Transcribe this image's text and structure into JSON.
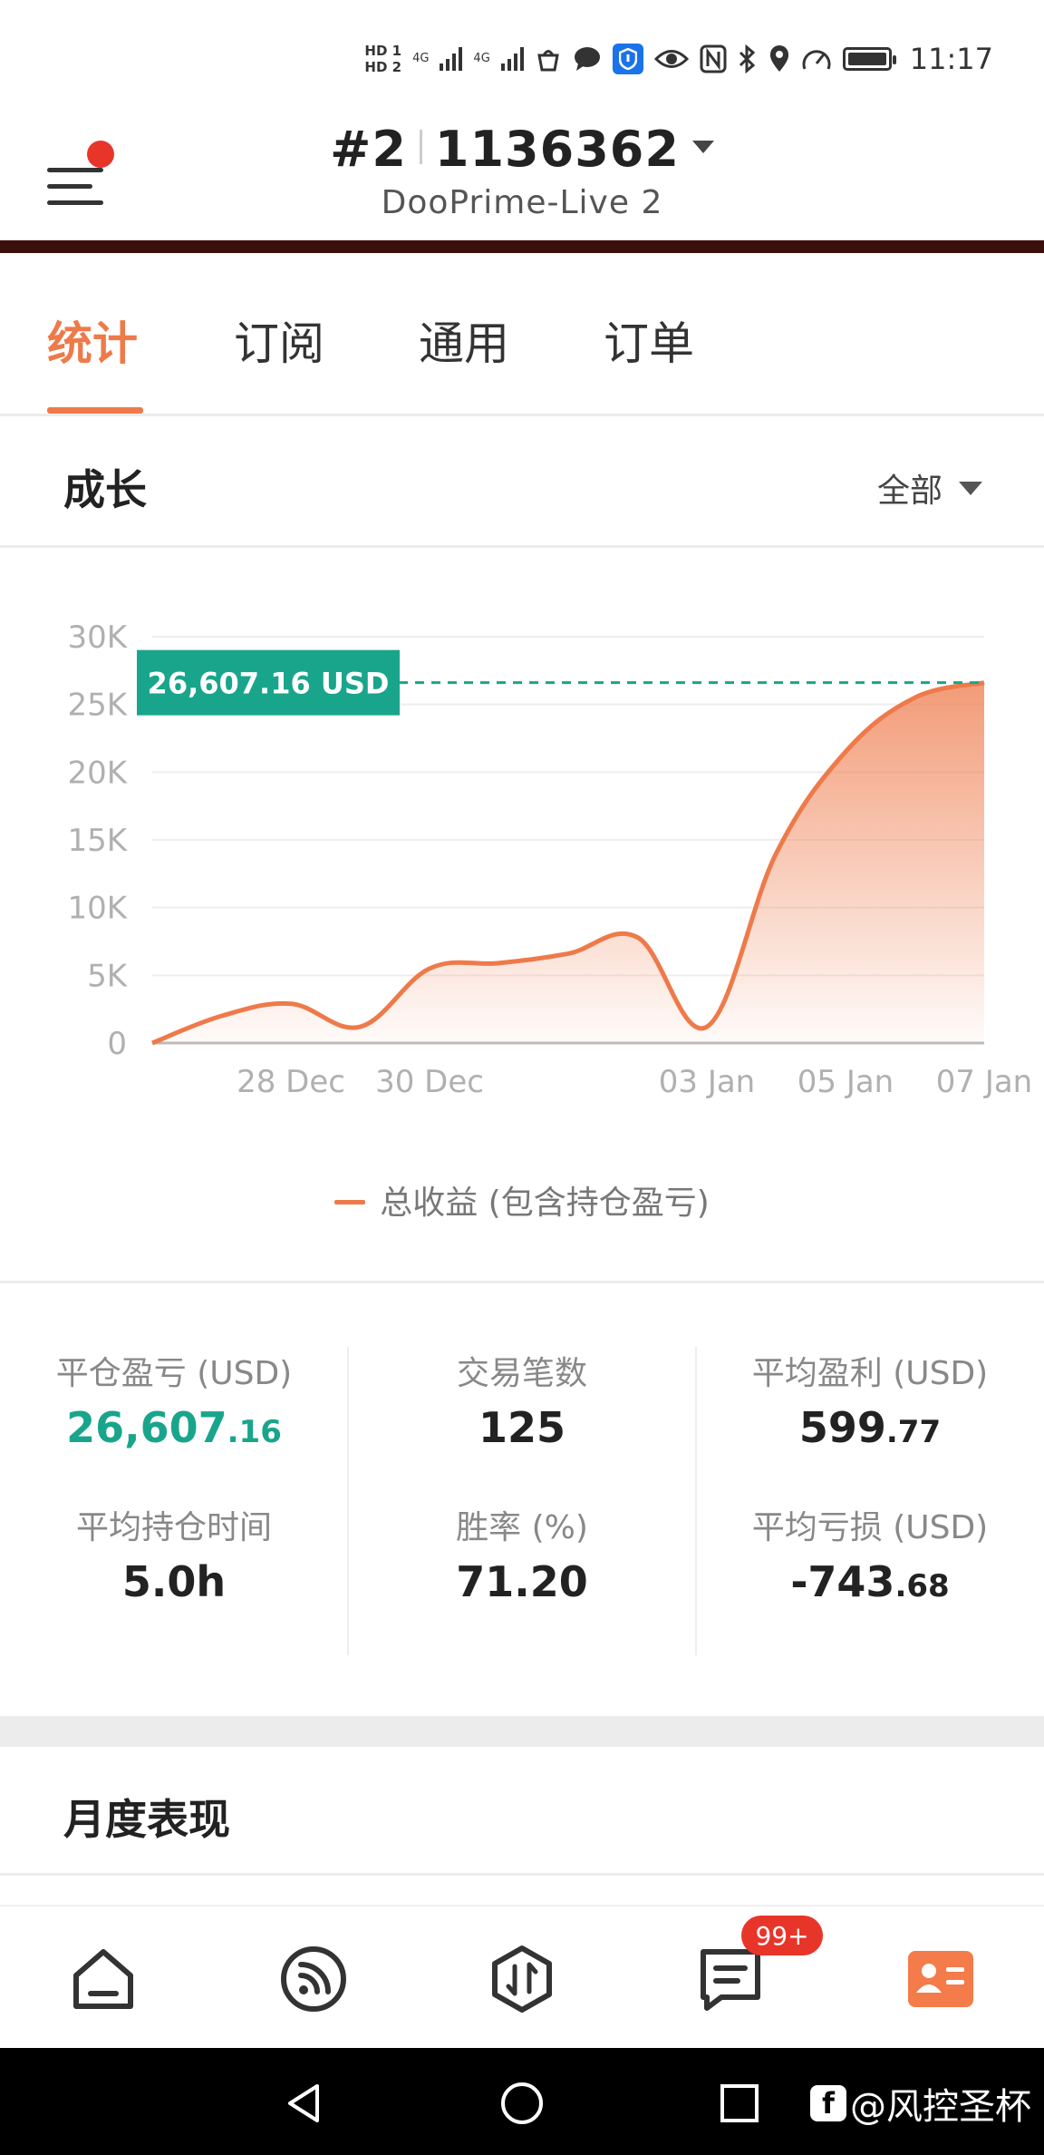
{
  "status_bar": {
    "time": "11:17",
    "sim1_label": "HD 1",
    "sim2_label": "HD 2",
    "network_label": "4G"
  },
  "header": {
    "account_prefix": "#2",
    "account_number": "1136362",
    "server": "DooPrime-Live 2"
  },
  "tabs": [
    {
      "label": "统计",
      "active": true
    },
    {
      "label": "订阅",
      "active": false
    },
    {
      "label": "通用",
      "active": false
    },
    {
      "label": "订单",
      "active": false
    }
  ],
  "growth": {
    "title": "成长",
    "range_label": "全部"
  },
  "chart_data": {
    "type": "area",
    "series": [
      {
        "name": "总收益 (包含持仓盈亏)",
        "color": "#ee7a4a",
        "x": [
          "2023-12-26",
          "2023-12-27",
          "2023-12-28",
          "2023-12-29",
          "2023-12-30",
          "2023-12-31",
          "2024-01-01",
          "2024-01-02",
          "2024-01-03",
          "2024-01-04",
          "2024-01-05",
          "2024-01-06",
          "2024-01-07"
        ],
        "values": [
          0,
          2000,
          2900,
          1200,
          5500,
          5900,
          6600,
          7800,
          1200,
          14000,
          21500,
          25500,
          26607.16
        ]
      }
    ],
    "xticks": [
      "28 Dec",
      "30 Dec",
      "03 Jan",
      "05 Jan",
      "07 Jan"
    ],
    "yticks": [
      "0",
      "5K",
      "10K",
      "15K",
      "20K",
      "25K",
      "30K"
    ],
    "ylim": [
      0,
      30000
    ],
    "grid": true,
    "legend_position": "bottom-center",
    "annotation": {
      "label": "26,607.16 USD",
      "value": 26607.16,
      "color": "#19a58b"
    }
  },
  "stats": [
    {
      "label": "平仓盈亏 (USD)",
      "int": "26,607",
      "dec": ".16",
      "highlight": true
    },
    {
      "label": "交易笔数",
      "int": "125",
      "dec": "",
      "highlight": false
    },
    {
      "label": "平均盈利 (USD)",
      "int": "599",
      "dec": ".77",
      "highlight": false
    },
    {
      "label": "平均持仓时间",
      "int": "5.0h",
      "dec": "",
      "highlight": false
    },
    {
      "label": "胜率 (%)",
      "int": "71.20",
      "dec": "",
      "highlight": false
    },
    {
      "label": "平均亏损 (USD)",
      "int": "-743",
      "dec": ".68",
      "highlight": false
    }
  ],
  "monthly": {
    "title": "月度表现"
  },
  "bottom_nav": {
    "messages_badge": "99+",
    "icons": [
      "home-icon",
      "feed-icon",
      "trade-icon",
      "messages-icon",
      "profile-card-icon"
    ]
  },
  "watermark": {
    "text": "@风控圣杯",
    "logo": "f"
  },
  "colors": {
    "accent": "#ee7a4a",
    "green": "#19a58b",
    "badge": "#e8352a"
  }
}
